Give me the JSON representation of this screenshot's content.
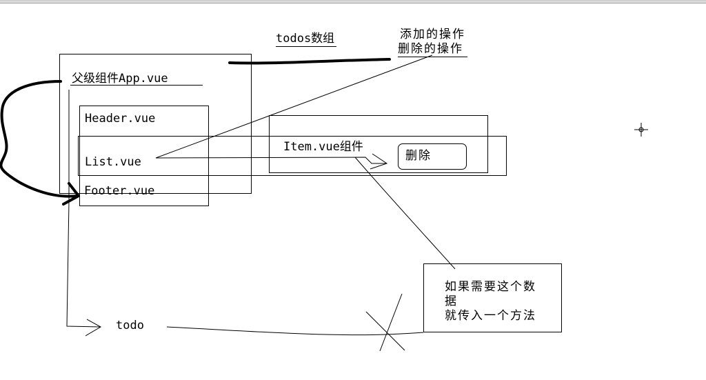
{
  "title": "todos数组",
  "ops": {
    "add": "添加的操作",
    "delete": "删除的操作"
  },
  "components": {
    "app": "父级组件App.vue",
    "header": "Header.vue",
    "list": "List.vue",
    "footer": "Footer.vue",
    "item": "Item.vue组件",
    "delete_button": "删除"
  },
  "todo_label": "todo",
  "note": {
    "line1": "如果需要这个数",
    "line2": "据",
    "line3": "就传入一个方法"
  }
}
